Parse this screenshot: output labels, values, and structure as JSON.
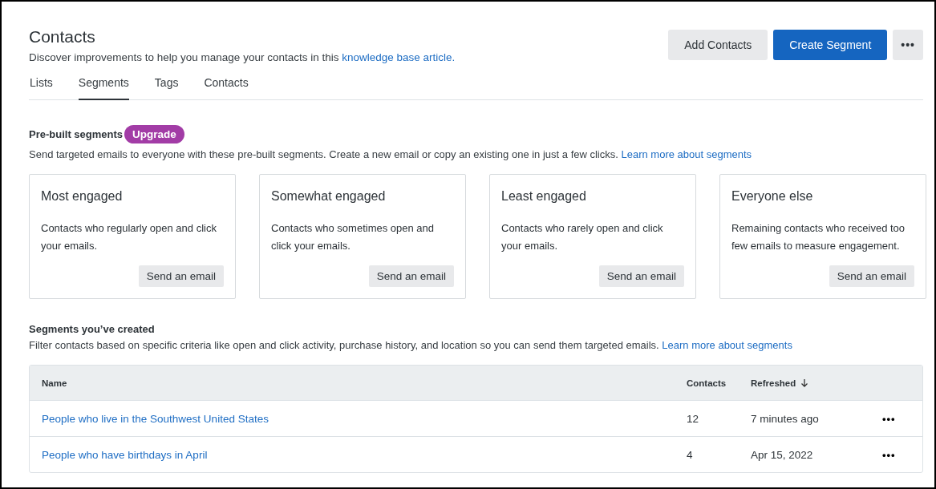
{
  "header": {
    "title": "Contacts",
    "description": "Discover improvements to help you manage your contacts in this",
    "description_link": "knowledge base article.",
    "buttons": [
      {
        "label": "Add Contacts",
        "kind": "secondary"
      },
      {
        "label": "Create Segment",
        "kind": "primary"
      },
      {
        "label": "•••",
        "kind": "more"
      }
    ]
  },
  "tabs": [
    {
      "label": "Lists",
      "selected": false
    },
    {
      "label": "Segments",
      "selected": true
    },
    {
      "label": "Tags",
      "selected": false
    },
    {
      "label": "Contacts",
      "selected": false
    }
  ],
  "prebuilt": {
    "title": "Pre-built segments",
    "badge": "Upgrade",
    "description": "Send targeted emails to everyone with these pre-built segments. Create a new email or copy an existing one in just a few clicks.",
    "link": "Learn more about segments",
    "cards": [
      {
        "title": "Most engaged",
        "text": "Contacts who regularly open and click your emails.",
        "button": "Send an email"
      },
      {
        "title": "Somewhat engaged",
        "text": "Contacts who sometimes open and click your emails.",
        "button": "Send an email"
      },
      {
        "title": "Least engaged",
        "text": "Contacts who rarely open and click your emails.",
        "button": "Send an email"
      },
      {
        "title": "Everyone else",
        "text": "Remaining contacts who received too few emails to measure engagement.",
        "button": "Send an email"
      }
    ]
  },
  "created": {
    "title": "Segments you’ve created",
    "description": "Filter contacts based on specific criteria like open and click activity, purchase history, and location so you can send them targeted emails.",
    "link": "Learn more about segments",
    "table": {
      "columns": [
        "Name",
        "Contacts",
        "Refreshed"
      ],
      "rows": [
        {
          "name": "People who live in the Southwest United States",
          "contacts": "12",
          "refreshed": "7 minutes ago",
          "actions": "•••"
        },
        {
          "name": "People who have birthdays in April",
          "contacts": "4",
          "refreshed": "Apr 15, 2022",
          "actions": "•••"
        }
      ]
    }
  }
}
